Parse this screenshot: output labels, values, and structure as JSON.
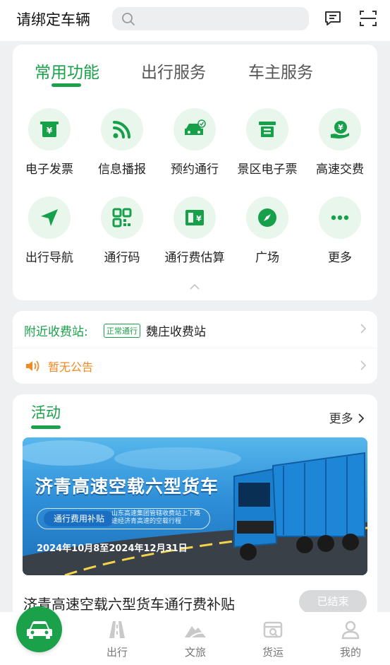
{
  "header": {
    "title": "请绑定车辆",
    "search_placeholder": "",
    "icons": [
      "message-icon",
      "scan-icon"
    ]
  },
  "functions": {
    "tabs": [
      {
        "label": "常用功能",
        "active": true
      },
      {
        "label": "出行服务",
        "active": false
      },
      {
        "label": "车主服务",
        "active": false
      }
    ],
    "items": [
      {
        "label": "电子发票",
        "icon": "e-invoice-icon"
      },
      {
        "label": "信息播报",
        "icon": "broadcast-icon"
      },
      {
        "label": "预约通行",
        "icon": "reservation-car-icon"
      },
      {
        "label": "景区电子票",
        "icon": "scenic-ticket-icon"
      },
      {
        "label": "高速交费",
        "icon": "highway-pay-icon"
      },
      {
        "label": "出行导航",
        "icon": "navigation-icon"
      },
      {
        "label": "通行码",
        "icon": "qr-code-icon"
      },
      {
        "label": "通行费估算",
        "icon": "toll-estimate-icon"
      },
      {
        "label": "广场",
        "icon": "compass-icon"
      },
      {
        "label": "更多",
        "icon": "more-dots-icon"
      }
    ]
  },
  "toll": {
    "label": "附近收费站:",
    "badge": "正常通行",
    "station": "魏庄收费站",
    "notice": "暂无公告"
  },
  "activity": {
    "title": "活动",
    "more": "更多",
    "banner_title": "济青高速空载六型货车",
    "banner_pill": "通行费用补贴",
    "banner_note": "山东高速集团管辖收费站上下路 途经济青高速的空载行程",
    "banner_date": "2024年10月8至2024年12月31日",
    "name": "济青高速空载六型货车通行费补贴",
    "status": "已结束"
  },
  "nav": {
    "items": [
      {
        "label": "出行",
        "icon": "road-icon"
      },
      {
        "label": "文旅",
        "icon": "travel-icon"
      },
      {
        "label": "货运",
        "icon": "freight-icon"
      },
      {
        "label": "我的",
        "icon": "user-icon"
      }
    ]
  },
  "colors": {
    "accent": "#1aa14a",
    "notice": "#f08a24",
    "background": "#eef0f2"
  }
}
